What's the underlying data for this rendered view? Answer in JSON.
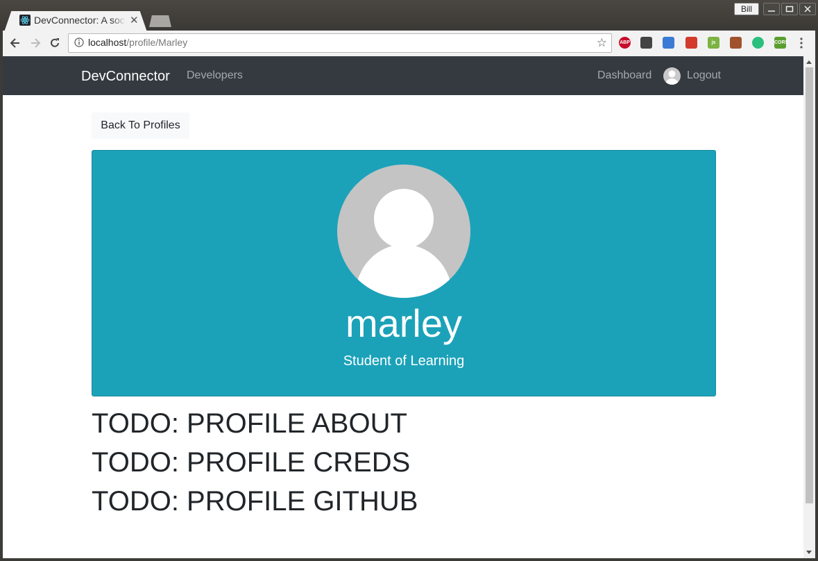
{
  "window": {
    "user": "Bill"
  },
  "browser": {
    "tab_title": "DevConnector: A social network for developers",
    "url_host": "localhost",
    "url_path": "/profile/Marley",
    "extensions": [
      {
        "name": "adblock-plus-icon",
        "label": "ABP",
        "color": "#c70d2c"
      },
      {
        "name": "sync-icon",
        "label": "",
        "color": "#444444"
      },
      {
        "name": "color-picker-icon",
        "label": "",
        "color": "#3a7bd5"
      },
      {
        "name": "flag-icon",
        "label": "",
        "color": "#d33a2c"
      },
      {
        "name": "js-icon",
        "label": "js",
        "color": "#7cb342"
      },
      {
        "name": "monkey-icon",
        "label": "",
        "color": "#a0522d"
      },
      {
        "name": "react-devtools-icon",
        "label": "",
        "color": "#2bbf7e"
      },
      {
        "name": "cors-icon",
        "label": "CORS",
        "color": "#5a9e2f"
      }
    ]
  },
  "navbar": {
    "brand": "DevConnector",
    "developers": "Developers",
    "dashboard": "Dashboard",
    "logout": "Logout"
  },
  "page": {
    "back_button": "Back To Profiles",
    "profile": {
      "name": "marley",
      "status": "Student of Learning"
    },
    "todos": [
      "TODO: PROFILE ABOUT",
      "TODO: PROFILE CREDS",
      "TODO: PROFILE GITHUB"
    ]
  },
  "colors": {
    "navbar_bg": "#343a40",
    "card_bg": "#1ba2b9"
  }
}
